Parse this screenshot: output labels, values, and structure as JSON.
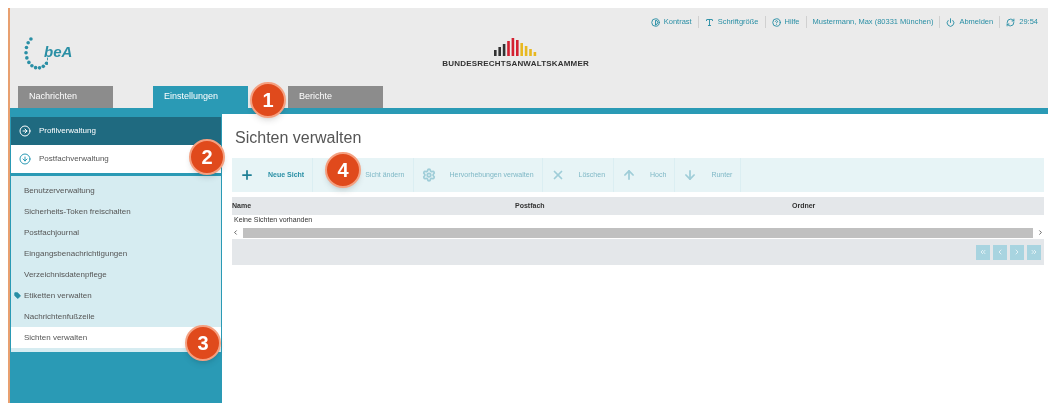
{
  "top_links": [
    {
      "label": "Kontrast"
    },
    {
      "label": "Schriftgröße"
    },
    {
      "label": "Hilfe"
    },
    {
      "label": "Mustermann, Max (80331 München)"
    },
    {
      "label": "Abmelden"
    },
    {
      "label": "29:54"
    }
  ],
  "logo": {
    "text": "beA"
  },
  "brand": {
    "text": "BUNDESRECHTSANWALTSKAMMER"
  },
  "tabs": [
    {
      "label": "Nachrichten",
      "selected": false
    },
    {
      "label": "Einstellungen",
      "selected": true
    },
    {
      "label": "Berichte",
      "selected": false
    }
  ],
  "sidebar": [
    {
      "label": "Profilverwaltung",
      "expanded": false
    },
    {
      "label": "Postfachverwaltung",
      "expanded": true,
      "children": [
        {
          "label": "Benutzerverwaltung",
          "selected": false
        },
        {
          "label": "Sicherheits-Token freischalten",
          "selected": false
        },
        {
          "label": "Postfachjournal",
          "selected": false
        },
        {
          "label": "Eingangsbenachrichtigungen",
          "selected": false
        },
        {
          "label": "Verzeichnisdatenpflege",
          "selected": false
        },
        {
          "label": "Etiketten verwalten",
          "selected": false,
          "kind": "tagged"
        },
        {
          "label": "Nachrichtenfußzeile",
          "selected": false
        },
        {
          "label": "Sichten verwalten",
          "selected": true
        }
      ]
    }
  ],
  "page_title": "Sichten verwalten",
  "toolbar": [
    {
      "label": "Neue Sicht",
      "disabled": false
    },
    {
      "label": "Sicht ändern",
      "disabled": true
    },
    {
      "label": "Hervorhebungen verwalten",
      "disabled": true
    },
    {
      "label": "Löschen",
      "disabled": true
    },
    {
      "label": "Hoch",
      "disabled": true
    },
    {
      "label": "Runter",
      "disabled": true
    }
  ],
  "table": {
    "columns": [
      "Name",
      "Postfach",
      "Ordner"
    ],
    "empty_message": "Keine Sichten vorhanden"
  },
  "callouts": [
    {
      "text": "1"
    },
    {
      "text": "2"
    },
    {
      "text": "3"
    },
    {
      "text": "4"
    }
  ]
}
